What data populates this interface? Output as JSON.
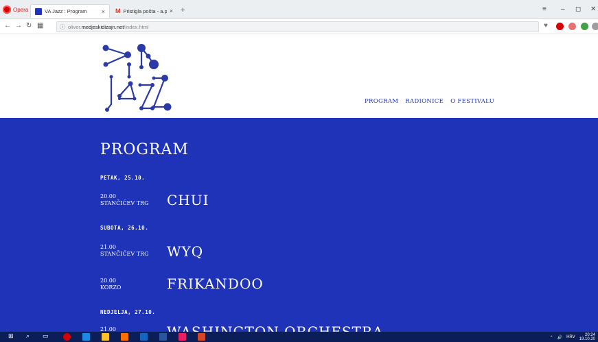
{
  "browser": {
    "opera_label": "Opera",
    "tabs": [
      {
        "title": "VA Jazz : Program",
        "active": true
      },
      {
        "title": "Pristigla pošta - a.potocnik",
        "active": false
      }
    ],
    "new_tab": "+",
    "url_prefix": "oliver.",
    "url_host": "medjeskidizajn.net",
    "url_path": "/index.html"
  },
  "site": {
    "nav": [
      "PROGRAM",
      "RADIONICE",
      "O FESTIVALU"
    ],
    "page_title": "PROGRAM",
    "days": [
      {
        "label": "PETAK, 25.10.",
        "events": [
          {
            "time": "20.00",
            "place": "STANČIĆEV TRG",
            "name": "CHUI"
          }
        ]
      },
      {
        "label": "SUBOTA, 26.10.",
        "events": [
          {
            "time": "21.00",
            "place": "STANČIĆEV TRG",
            "name": "WYQ"
          },
          {
            "time": "20.00",
            "place": "KORZO",
            "name": "FRIKANDOO"
          }
        ]
      },
      {
        "label": "NEDJELJA, 27.10.",
        "events": [
          {
            "time": "21.00",
            "place": "",
            "name": "WASHINGTON ORCHESTRA"
          }
        ]
      }
    ]
  },
  "colors": {
    "brand_blue": "#1f33b8",
    "taskbar": "#0c1e58"
  },
  "taskbar": {
    "lang": "HRV",
    "clock_time": "20:24",
    "clock_date": "19.10.20"
  }
}
